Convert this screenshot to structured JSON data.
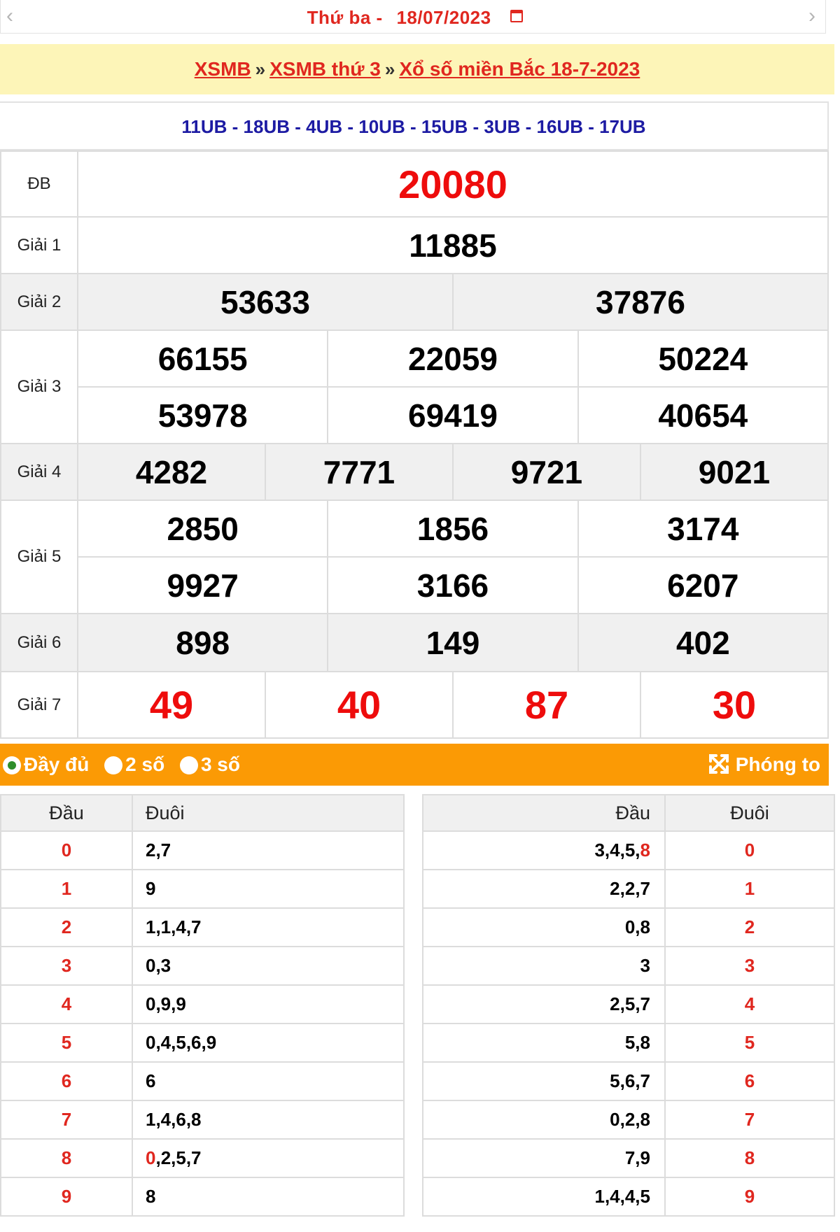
{
  "date_nav": {
    "prev_icon": "chevron-left-icon",
    "next_icon": "chevron-right-icon",
    "weekday": "Thứ ba -",
    "date": "18/07/2023",
    "calendar_icon": "calendar-icon"
  },
  "breadcrumb": {
    "items": [
      "XSMB",
      "XSMB thứ 3",
      "Xổ số miền Bắc 18-7-2023"
    ],
    "separator": "»"
  },
  "codes": "11UB - 18UB - 4UB - 10UB - 15UB - 3UB - 16UB - 17UB",
  "prizes": {
    "db": {
      "label": "ĐB",
      "numbers": [
        "20080"
      ]
    },
    "g1": {
      "label": "Giải 1",
      "numbers": [
        "11885"
      ]
    },
    "g2": {
      "label": "Giải 2",
      "numbers": [
        "53633",
        "37876"
      ]
    },
    "g3": {
      "label": "Giải 3",
      "numbers": [
        "66155",
        "22059",
        "50224",
        "53978",
        "69419",
        "40654"
      ]
    },
    "g4": {
      "label": "Giải 4",
      "numbers": [
        "4282",
        "7771",
        "9721",
        "9021"
      ]
    },
    "g5": {
      "label": "Giải 5",
      "numbers": [
        "2850",
        "1856",
        "3174",
        "9927",
        "3166",
        "6207"
      ]
    },
    "g6": {
      "label": "Giải 6",
      "numbers": [
        "898",
        "149",
        "402"
      ]
    },
    "g7": {
      "label": "Giải 7",
      "numbers": [
        "49",
        "40",
        "87",
        "30"
      ]
    }
  },
  "options": {
    "full": "Đầy đủ",
    "two": "2 số",
    "three": "3 số",
    "selected": "full",
    "zoom_label": "Phóng to",
    "zoom_icon": "expand-icon"
  },
  "loto_left": {
    "header_dau": "Đầu",
    "header_duoi": "Đuôi",
    "rows": [
      {
        "head": "0",
        "tails": "2,7"
      },
      {
        "head": "1",
        "tails": "9"
      },
      {
        "head": "2",
        "tails": "1,1,4,7"
      },
      {
        "head": "3",
        "tails": "0,3"
      },
      {
        "head": "4",
        "tails": "0,9,9"
      },
      {
        "head": "5",
        "tails": "0,4,5,6,9"
      },
      {
        "head": "6",
        "tails": "6"
      },
      {
        "head": "7",
        "tails": "1,4,6,8"
      },
      {
        "head": "8",
        "tails_red": "0",
        "tails": ",2,5,7"
      },
      {
        "head": "9",
        "tails": "8"
      }
    ]
  },
  "loto_right": {
    "header_dau": "Đầu",
    "header_duoi": "Đuôi",
    "rows": [
      {
        "heads": "3,4,5,",
        "heads_red": "8",
        "tail": "0"
      },
      {
        "heads": "2,2,7",
        "tail": "1"
      },
      {
        "heads": "0,8",
        "tail": "2"
      },
      {
        "heads": "3",
        "tail": "3"
      },
      {
        "heads": "2,5,7",
        "tail": "4"
      },
      {
        "heads": "5,8",
        "tail": "5"
      },
      {
        "heads": "5,6,7",
        "tail": "6"
      },
      {
        "heads": "0,2,8",
        "tail": "7"
      },
      {
        "heads": "7,9",
        "tail": "8"
      },
      {
        "heads": "1,4,4,5",
        "tail": "9"
      }
    ]
  }
}
